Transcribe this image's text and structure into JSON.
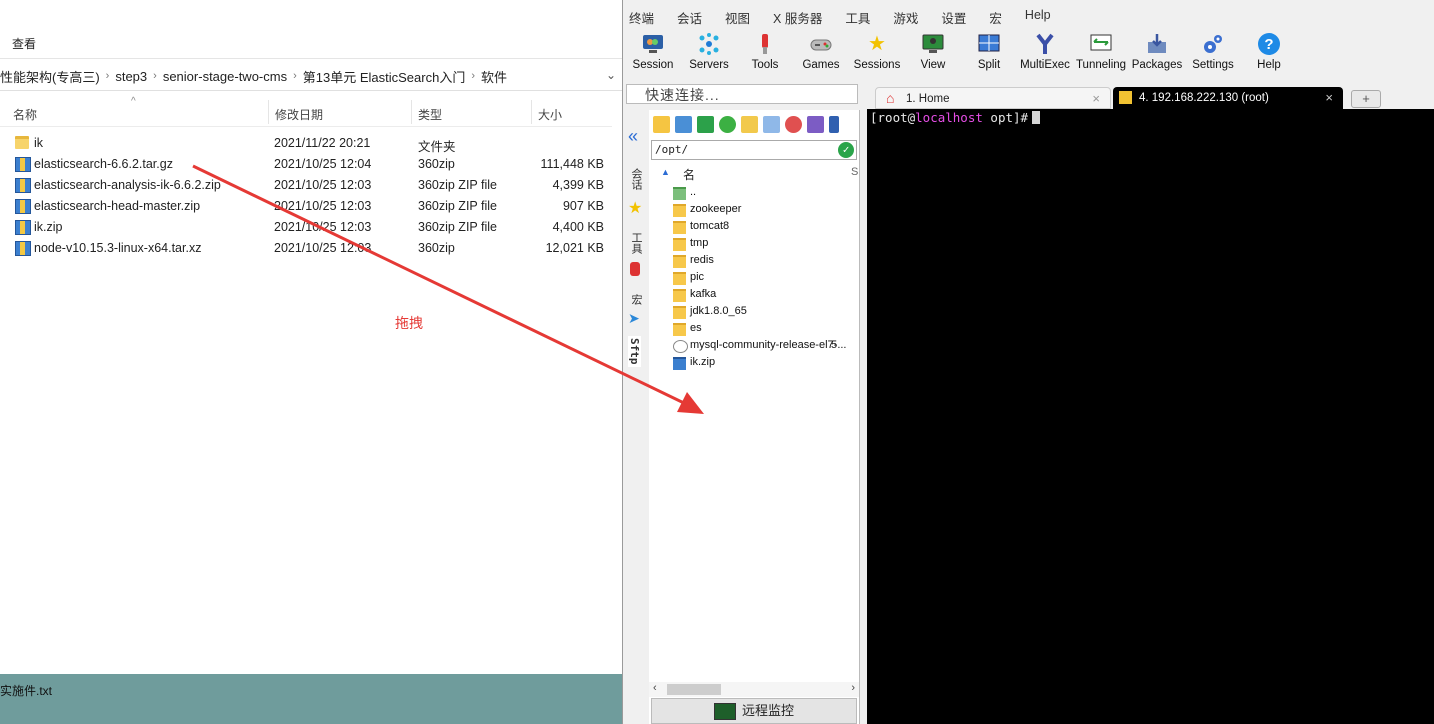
{
  "explorer": {
    "view_tab": "查看",
    "breadcrumb": [
      "性能架构(专高三)",
      "step3",
      "senior-stage-two-cms",
      "第13单元 ElasticSearch入门",
      "软件"
    ],
    "columns": {
      "name": "名称",
      "date": "修改日期",
      "type": "类型",
      "size": "大小"
    },
    "files": [
      {
        "name": "ik",
        "date": "2021/11/22 20:21",
        "type": "文件夹",
        "size": "",
        "icon": "folder-icon"
      },
      {
        "name": "elasticsearch-6.6.2.tar.gz",
        "date": "2021/10/25 12:04",
        "type": "360zip",
        "size": "111,448 KB",
        "icon": "archive-icon"
      },
      {
        "name": "elasticsearch-analysis-ik-6.6.2.zip",
        "date": "2021/10/25 12:03",
        "type": "360zip ZIP file",
        "size": "4,399 KB",
        "icon": "archive-icon"
      },
      {
        "name": "elasticsearch-head-master.zip",
        "date": "2021/10/25 12:03",
        "type": "360zip ZIP file",
        "size": "907 KB",
        "icon": "archive-icon"
      },
      {
        "name": "ik.zip",
        "date": "2021/10/25 12:03",
        "type": "360zip ZIP file",
        "size": "4,400 KB",
        "icon": "archive-icon"
      },
      {
        "name": "node-v10.15.3-linux-x64.tar.xz",
        "date": "2021/10/25 12:03",
        "type": "360zip",
        "size": "12,021 KB",
        "icon": "archive-icon"
      }
    ],
    "annotation": "拖拽",
    "annotation_color": "#e53935"
  },
  "desktop": {
    "file_label": "实施件.txt"
  },
  "moba": {
    "menu": [
      "终端",
      "会话",
      "视图",
      "X 服务器",
      "工具",
      "游戏",
      "设置",
      "宏",
      "Help"
    ],
    "toolbar": [
      {
        "label": "Session",
        "icon": "session-icon"
      },
      {
        "label": "Servers",
        "icon": "servers-icon"
      },
      {
        "label": "Tools",
        "icon": "tools-icon"
      },
      {
        "label": "Games",
        "icon": "games-icon"
      },
      {
        "label": "Sessions",
        "icon": "star-icon"
      },
      {
        "label": "View",
        "icon": "view-icon"
      },
      {
        "label": "Split",
        "icon": "split-icon"
      },
      {
        "label": "MultiExec",
        "icon": "multiexec-icon"
      },
      {
        "label": "Tunneling",
        "icon": "tunneling-icon"
      },
      {
        "label": "Packages",
        "icon": "packages-icon"
      },
      {
        "label": "Settings",
        "icon": "settings-icon"
      },
      {
        "label": "Help",
        "icon": "help-icon"
      }
    ],
    "quick_connect": "快速连接...",
    "tabs": [
      {
        "label": "1. Home",
        "icon": "home-icon"
      },
      {
        "label": "4. 192.168.222.130 (root)",
        "icon": "key-icon"
      }
    ],
    "side_tabs": [
      "会话",
      "工具",
      "宏",
      "Sftp"
    ],
    "sftp": {
      "path": "/opt/",
      "name_header": "名",
      "items": [
        "..",
        "zookeeper",
        "tomcat8",
        "tmp",
        "redis",
        "pic",
        "kafka",
        "jdk1.8.0_65",
        "es",
        "mysql-community-release-el7-...",
        "ik.zip"
      ],
      "size_col": [
        "",
        "",
        "",
        "",
        "",
        "",
        "",
        "",
        "",
        "5",
        ""
      ]
    },
    "monitor_label": "远程监控"
  },
  "terminal": {
    "prompt_user": "[root@",
    "prompt_host": "localhost",
    "prompt_rest": " opt]#"
  }
}
